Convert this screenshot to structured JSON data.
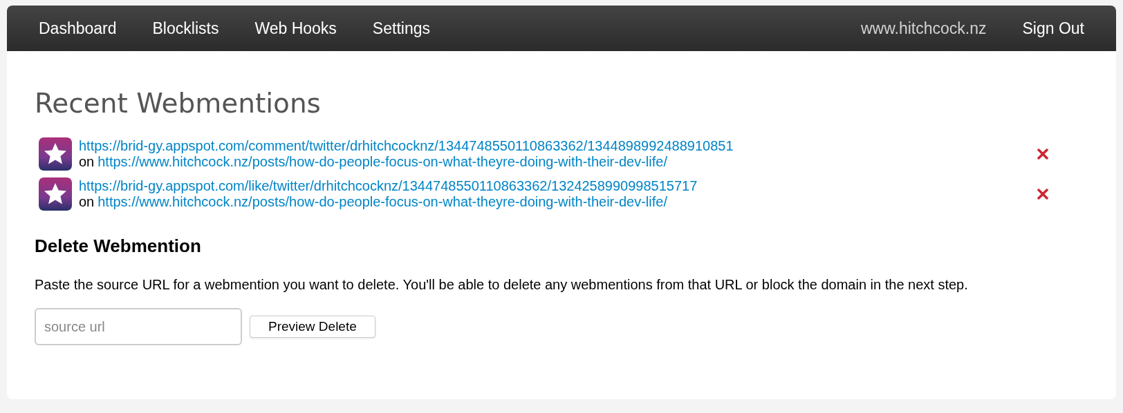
{
  "nav": {
    "items": [
      {
        "label": "Dashboard"
      },
      {
        "label": "Blocklists"
      },
      {
        "label": "Web Hooks"
      },
      {
        "label": "Settings"
      }
    ],
    "site": "www.hitchcock.nz",
    "sign_out": "Sign Out"
  },
  "heading": "Recent Webmentions",
  "webmentions": [
    {
      "source": "https://brid-gy.appspot.com/comment/twitter/drhitchcocknz/1344748550110863362/1344898992488910851",
      "on": "on",
      "target": "https://www.hitchcock.nz/posts/how-do-people-focus-on-what-theyre-doing-with-their-dev-life/"
    },
    {
      "source": "https://brid-gy.appspot.com/like/twitter/drhitchcocknz/1344748550110863362/1324258990998515717",
      "on": "on",
      "target": "https://www.hitchcock.nz/posts/how-do-people-focus-on-what-theyre-doing-with-their-dev-life/"
    }
  ],
  "delete": {
    "title": "Delete Webmention",
    "description": "Paste the source URL for a webmention you want to delete. You'll be able to delete any webmentions from that URL or block the domain in the next step.",
    "placeholder": "source url",
    "button": "Preview Delete"
  }
}
